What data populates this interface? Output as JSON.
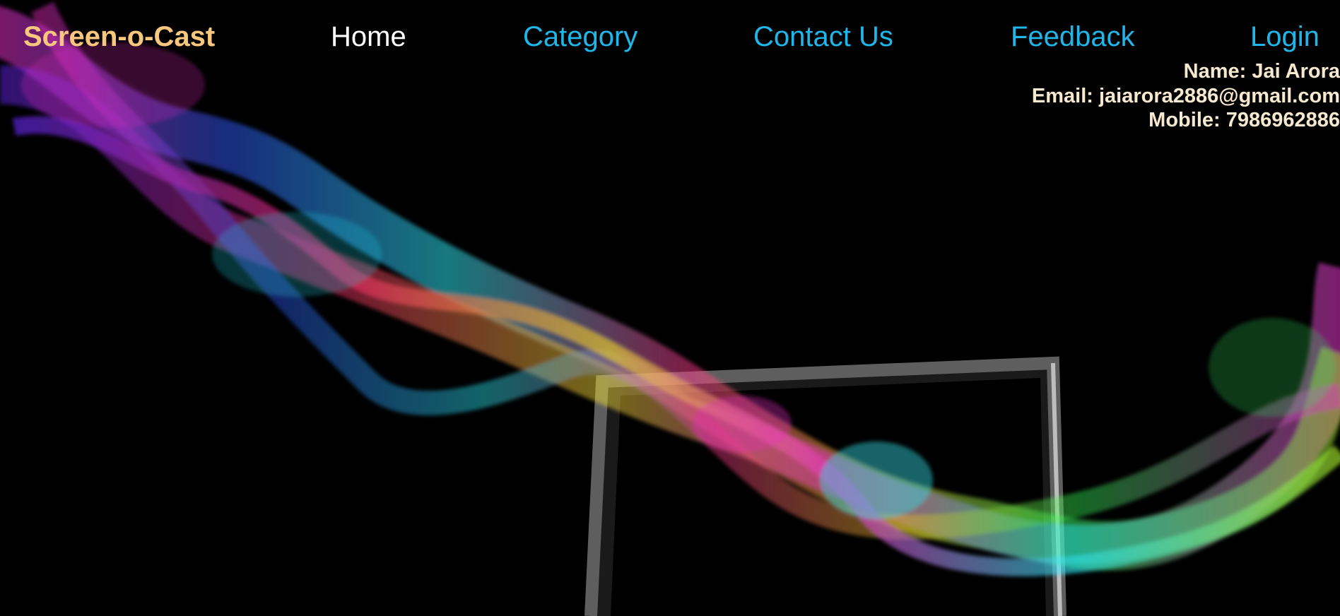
{
  "brand": {
    "name": "Screen-o-Cast"
  },
  "nav": {
    "items": [
      {
        "label": "Home"
      },
      {
        "label": "Category"
      },
      {
        "label": "Contact Us"
      },
      {
        "label": "Feedback"
      },
      {
        "label": "Login"
      }
    ]
  },
  "user": {
    "name_line": "Name: Jai Arora",
    "email_line": "Email: jaiarora2886@gmail.com",
    "mobile_line": "Mobile: 7986962886"
  },
  "colors": {
    "background": "#000000",
    "brand": "#f6c77c",
    "nav_active": "#ffffff",
    "nav_link": "#1fb6ea",
    "user_text": "#f7e9cf"
  },
  "icons": {
    "hero": "laptop-with-rainbow-smoke-illustration"
  }
}
